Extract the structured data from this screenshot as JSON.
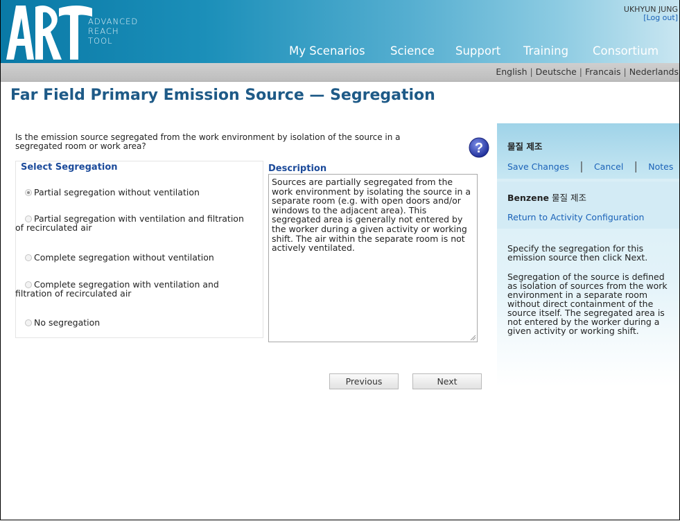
{
  "header": {
    "logo_sub": [
      "ADVANCED",
      "REACH",
      "TOOL"
    ],
    "user_name": "UKHYUN JUNG",
    "logout": "[Log out]",
    "nav": [
      {
        "label": "My Scenarios"
      },
      {
        "label": "Science"
      },
      {
        "label": "Support"
      },
      {
        "label": "Training"
      },
      {
        "label": "Consortium"
      }
    ]
  },
  "languages": [
    "English",
    "Deutsche",
    "Francais",
    "Nederlands"
  ],
  "page": {
    "title": "Far Field Primary Emission Source  —  Segregation",
    "question": "Is the emission source segregated from the work environment by isolation of the source in a segregated room or work area?"
  },
  "segregation": {
    "label": "Select Segregation",
    "options": [
      {
        "text": "Partial segregation without ventilation",
        "selected": true
      },
      {
        "text": "Partial segregation with ventilation and filtration of recirculated air",
        "selected": false
      },
      {
        "text": "Complete segregation without ventilation",
        "selected": false
      },
      {
        "text": "Complete segregation with ventilation and filtration of recirculated air",
        "selected": false
      },
      {
        "text": "No segregation",
        "selected": false
      }
    ]
  },
  "description": {
    "label": "Description",
    "text": "Sources are partially segregated from the work environment by isolating the source in a separate room (e.g. with open doors and/or windows to the adjacent area). This segregated area is generally not entered by the worker during a given activity or working shift. The air within the separate room is not actively ventilated."
  },
  "buttons": {
    "previous": "Previous",
    "next": "Next"
  },
  "sidebar": {
    "title1": "물질 제조",
    "save": "Save Changes",
    "cancel": "Cancel",
    "notes": "Notes",
    "title2_bold": "Benzene",
    "title2_rest": " 물질 제조",
    "return_link": "Return to Activity Configuration",
    "help1": "Specify the segregation for this emission source then click Next.",
    "help2": "Segregation of the source is defined as isolation of sources from the work environment in a separate room without direct containment of the source itself. The segregated area is not entered by the worker during a given activity or working shift."
  },
  "colors": {
    "header_dark": "#0a79a6",
    "title_blue": "#1e5a87",
    "link_blue": "#1a62b8",
    "sidebar_blue": "#9fd3e8"
  }
}
